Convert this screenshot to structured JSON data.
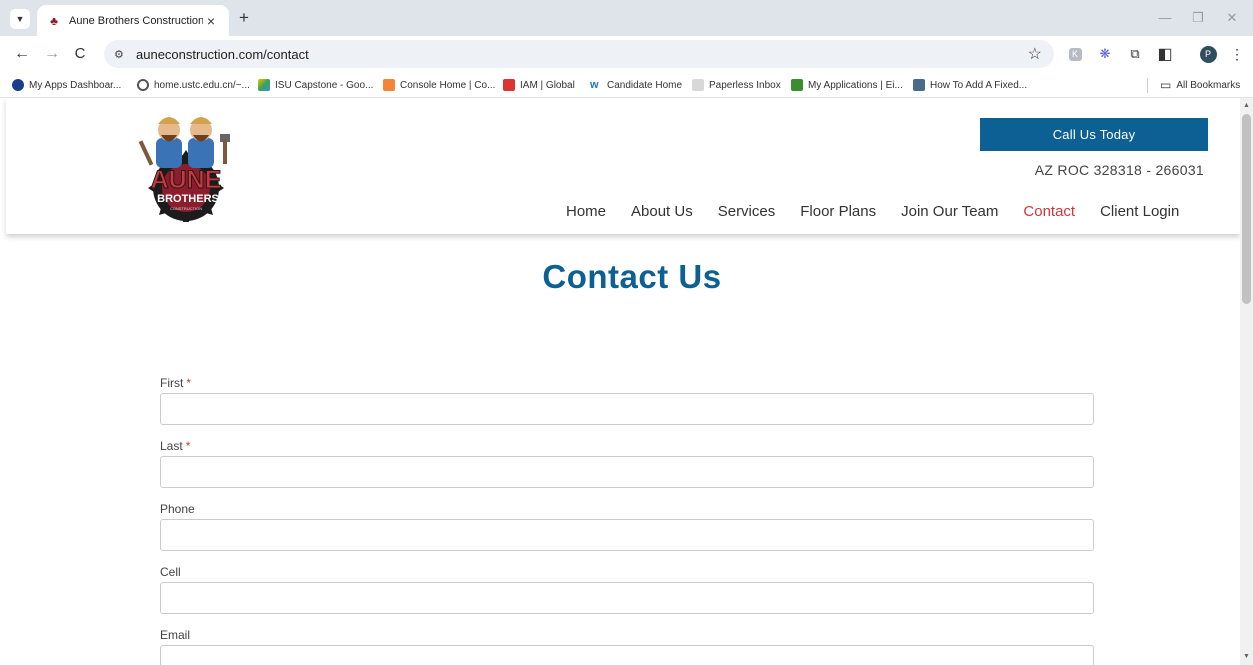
{
  "browser": {
    "tab_title": "Aune Brothers Construction",
    "url": "auneconstruction.com/contact",
    "profile_initial": "P",
    "bookmarks": [
      {
        "label": "My Apps Dashboar...",
        "color": "#1a3e8c"
      },
      {
        "label": "home.ustc.edu.cn/~...",
        "color": "#555555"
      },
      {
        "label": "ISU Capstone - Goo...",
        "color": "#34a853"
      },
      {
        "label": "Console Home | Co...",
        "color": "#f58536"
      },
      {
        "label": "IAM | Global",
        "color": "#dd3333"
      },
      {
        "label": "Candidate Home",
        "color": "#1f77c9"
      },
      {
        "label": "Paperless Inbox",
        "color": "#7d7d7d"
      },
      {
        "label": "My Applications | Ei...",
        "color": "#3c8d2f"
      },
      {
        "label": "How To Add A Fixed...",
        "color": "#4a6b8a"
      }
    ],
    "all_bookmarks": "All Bookmarks"
  },
  "header": {
    "logo_text_main": "AUNE",
    "logo_text_sub": "BROTHERS",
    "logo_text_small": "CONSTRUCTION",
    "call_button": "Call Us Today",
    "license": "AZ ROC 328318 - 266031",
    "nav": [
      {
        "label": "Home",
        "active": false
      },
      {
        "label": "About Us",
        "active": false
      },
      {
        "label": "Services",
        "active": false
      },
      {
        "label": "Floor Plans",
        "active": false
      },
      {
        "label": "Join Our Team",
        "active": false
      },
      {
        "label": "Contact",
        "active": true
      },
      {
        "label": "Client Login",
        "active": false
      }
    ]
  },
  "page": {
    "title": "Contact Us"
  },
  "form": {
    "fields": [
      {
        "label": "First",
        "required": true,
        "required_mark": "*",
        "value": ""
      },
      {
        "label": "Last",
        "required": true,
        "required_mark": "*",
        "value": ""
      },
      {
        "label": "Phone",
        "required": false,
        "value": ""
      },
      {
        "label": "Cell",
        "required": false,
        "value": ""
      },
      {
        "label": "Email",
        "required": false,
        "value": ""
      }
    ]
  },
  "colors": {
    "brand_blue": "#0d6094",
    "accent_red": "#d4343b"
  }
}
